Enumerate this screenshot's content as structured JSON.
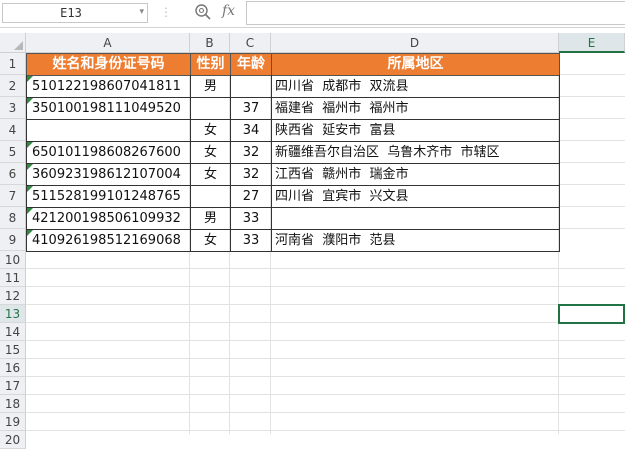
{
  "formula_bar": {
    "name_box": "E13",
    "fx_label": "fx",
    "formula_value": ""
  },
  "columns": [
    "A",
    "B",
    "C",
    "D",
    "E"
  ],
  "rows": [
    "1",
    "2",
    "3",
    "4",
    "5",
    "6",
    "7",
    "8",
    "9",
    "10",
    "11",
    "12",
    "13",
    "14",
    "15",
    "16",
    "17",
    "18",
    "19",
    "20"
  ],
  "table": {
    "headers": [
      "姓名和身份证号码",
      "性别",
      "年龄",
      "所属地区"
    ],
    "data": [
      [
        "510122198607041811",
        "男",
        "",
        "四川省  成都市  双流县"
      ],
      [
        "350100198111049520",
        "",
        "37",
        "福建省  福州市  福州市"
      ],
      [
        "",
        "女",
        "34",
        "陕西省  延安市  富县"
      ],
      [
        "650101198608267600",
        "女",
        "32",
        "新疆维吾尔自治区  乌鲁木齐市  市辖区"
      ],
      [
        "360923198612107004",
        "女",
        "32",
        "江西省  赣州市  瑞金市"
      ],
      [
        "511528199101248765",
        "",
        "27",
        "四川省  宜宾市  兴文县"
      ],
      [
        "421200198506109932",
        "男",
        "33",
        ""
      ],
      [
        "410926198512169068",
        "女",
        "33",
        "河南省  濮阳市  范县"
      ]
    ]
  },
  "selection": {
    "cell": "E13"
  },
  "colors": {
    "header_fill": "#ed7d31",
    "selection": "#217346",
    "error_marker": "#2e8b3e"
  }
}
